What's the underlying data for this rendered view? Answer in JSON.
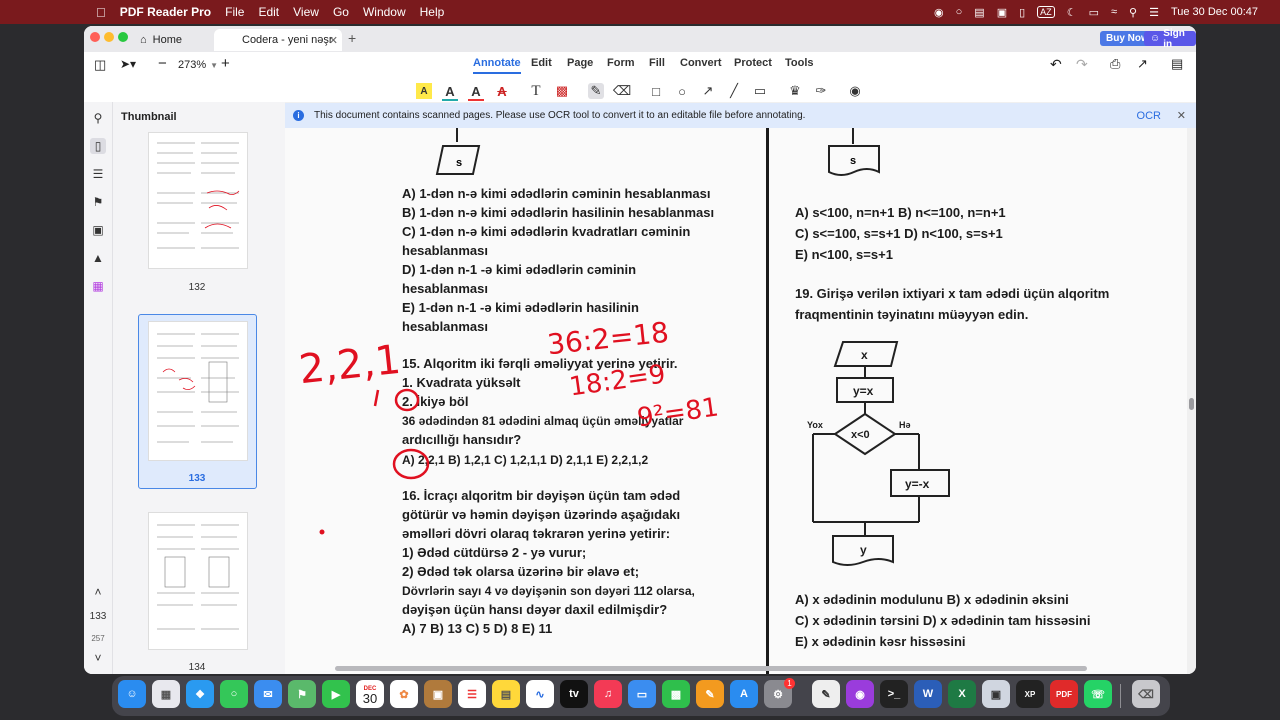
{
  "menubar": {
    "app": "PDF Reader Pro",
    "items": [
      "File",
      "Edit",
      "View",
      "Go",
      "Window",
      "Help"
    ],
    "clock": "Tue 30 Dec  00:47",
    "input": "AZ"
  },
  "tabs": {
    "home": "Home",
    "doc": "Codera - yeni nəşr"
  },
  "buttons": {
    "buy": "Buy Now",
    "signin": "Sign in"
  },
  "toolbar": {
    "zoom": "273%",
    "nav": [
      "Annotate",
      "Edit",
      "Page",
      "Form",
      "Fill",
      "Convert",
      "Protect",
      "Tools"
    ]
  },
  "sidebar": {
    "title": "Thumbnail",
    "pages": [
      "132",
      "133",
      "134"
    ],
    "current_page": "133",
    "total_pages": "257"
  },
  "banner": {
    "text": "This document contains scanned pages. Please use OCR tool to convert it to an editable file before annotating.",
    "ocr": "OCR"
  },
  "doc": {
    "left": [
      "A) 1-dən n-ə kimi ədədlərin cəminin hesablanması",
      "B) 1-dən n-ə kimi ədədlərin hasilinin hesablanması",
      "C) 1-dən n-ə kimi ədədlərin kvadratları cəminin",
      "hesablanması",
      "D) 1-dən n-1 -ə kimi ədədlərin cəminin",
      "hesablanması",
      "E) 1-dən n-1 -ə kimi ədədlərin hasilinin",
      "hesablanması",
      "15. Alqoritm iki fərqli əməliyyat yerinə yetirir.",
      "1.  Kvadrata yüksəlt",
      "2.  İkiyə böl",
      "36 ədədindən 81 ədədini almaq üçün əməliyyatlar",
      "ardıcıllığı hansıdır?",
      "A) 2,2,1    B) 1,2,1    C) 1,2,1,1    D) 2,1,1    E)  2,2,1,2",
      "16. İcraçı alqoritm bir dəyişən üçün tam ədəd",
      "götürür və həmin dəyişən üzərində aşağıdakı",
      "əməlləri dövri olaraq təkrarən yerinə yetirir:",
      "1)  Ədəd cütdürsə 2 - yə vurur;",
      "2)  Ədəd tək olarsa üzərinə bir əlavə et;",
      "Dövrlərin sayı 4 və dəyişənin son dəyəri 112  olarsa,",
      "dəyişən üçün hansı dəyər daxil edilmişdir?",
      "A) 7          B) 13          C) 5          D) 8          E) 11"
    ],
    "right": [
      "A) s<100, n=n+1        B) n<=100, n=n+1",
      "C) s<=100, s=s+1       D) n<100, s=s+1",
      "E) n<100, s=s+1",
      "19.  Girişə verilən ixtiyari x tam ədədi üçün alqoritm",
      "fraqmentinin təyinatını müəyyən edin.",
      "A) x ədədinin modulunu              B) x ədədinin əksini",
      "C) x ədədinin tərsini          D) x ədədinin tam hissəsini",
      "E) x ədədinin kəsr hissəsini"
    ],
    "flow": {
      "s_top": "s",
      "s_right": "s",
      "x": "x",
      "y_eq_x": "y=x",
      "cond": "x<0",
      "no": "Yox",
      "yes": "Hə",
      "y_eq_neg_x": "y=-x",
      "y_out": "y"
    },
    "handwriting": {
      "h1": "2,2,1",
      "h2": "36:2=18",
      "h3": "18:2=9",
      "h4": "9²=81"
    }
  },
  "dock": {
    "calendar_month": "DEC",
    "calendar_day": "30",
    "settings_badge": "1"
  },
  "colors": {
    "menubar": "#7a1a1d",
    "accent": "#2a6de0",
    "banner": "#dfeafc",
    "ink": "#e01020"
  }
}
